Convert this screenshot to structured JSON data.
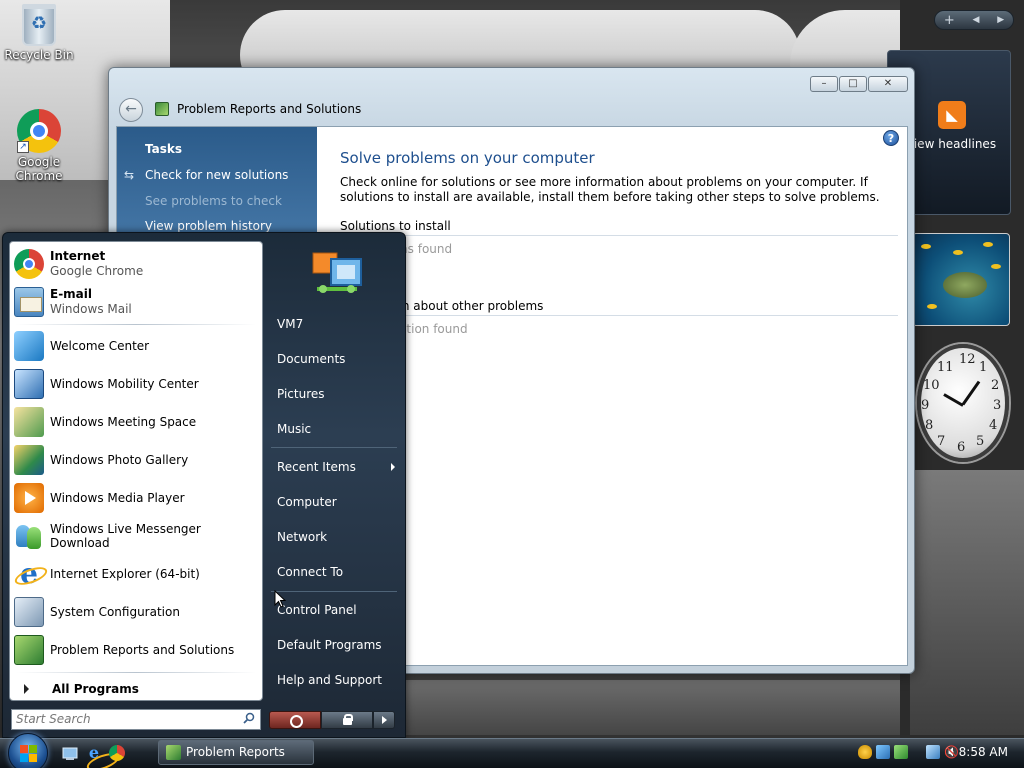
{
  "desktop": {
    "icons": [
      {
        "label": "Recycle Bin"
      },
      {
        "label": "Google Chrome"
      }
    ]
  },
  "gadgets": {
    "feed_label": "View headlines",
    "clock_numbers": [
      "12",
      "1",
      "2",
      "3",
      "4",
      "5",
      "6",
      "7",
      "8",
      "9",
      "10",
      "11"
    ]
  },
  "window": {
    "title": "Problem Reports and Solutions",
    "buttons": {
      "minimize": "–",
      "maximize": "□",
      "close": "✕"
    },
    "tasks": {
      "title": "Tasks",
      "items": [
        {
          "label": "Check for new solutions",
          "enabled": true
        },
        {
          "label": "See problems to check",
          "enabled": false
        },
        {
          "label": "View problem history",
          "enabled": true
        }
      ]
    },
    "content": {
      "title": "Solve problems on your computer",
      "description": "Check online for solutions or see more information about problems on your computer. If solutions to install are available, install them before taking other steps to solve problems.",
      "sections": [
        {
          "heading": "Solutions to install",
          "note": "No solutions found"
        },
        {
          "heading": "Information about other problems",
          "note": "No information found"
        }
      ]
    }
  },
  "start_menu": {
    "pinned": [
      {
        "name": "Internet",
        "sub": "Google Chrome"
      },
      {
        "name": "E-mail",
        "sub": "Windows Mail"
      }
    ],
    "recent": [
      "Welcome Center",
      "Windows Mobility Center",
      "Windows Meeting Space",
      "Windows Photo Gallery",
      "Windows Media Player",
      "Windows Live Messenger Download",
      "Internet Explorer (64-bit)",
      "System Configuration",
      "Problem Reports and Solutions"
    ],
    "all_programs": "All Programs",
    "search_placeholder": "Start Search",
    "right_links": [
      "VM7",
      "Documents",
      "Pictures",
      "Music",
      "Recent Items",
      "Computer",
      "Network",
      "Connect To",
      "Control Panel",
      "Default Programs",
      "Help and Support"
    ]
  },
  "taskbar": {
    "open_task": "Problem Reports an...",
    "clock": "8:58 AM"
  }
}
